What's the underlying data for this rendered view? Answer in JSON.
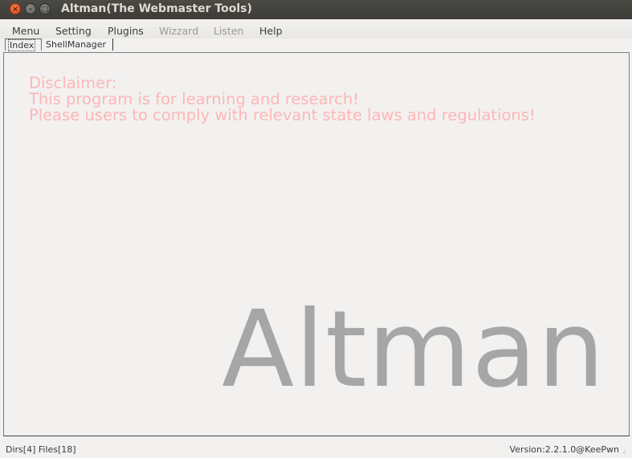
{
  "window": {
    "title": "Altman(The Webmaster Tools)",
    "close_glyph": "×",
    "minimize_glyph": "–",
    "maximize_glyph": "□"
  },
  "menubar": {
    "items": [
      {
        "label": "Menu",
        "enabled": true
      },
      {
        "label": "Setting",
        "enabled": true
      },
      {
        "label": "Plugins",
        "enabled": true
      },
      {
        "label": "Wizzard",
        "enabled": false
      },
      {
        "label": "Listen",
        "enabled": false
      },
      {
        "label": "Help",
        "enabled": true
      }
    ]
  },
  "tabs": [
    {
      "label": "Index",
      "selected": true
    },
    {
      "label": "ShellManager",
      "selected": false
    }
  ],
  "main": {
    "disclaimer": [
      "Disclaimer:",
      "This program is for learning and research!",
      "Please users to comply with relevant state laws and regulations!"
    ],
    "logo_text": "Altman"
  },
  "statusbar": {
    "left": "Dirs[4] Files[18]",
    "right": "Version:2.2.1.0@KeePwn",
    "grip": ".:"
  },
  "colors": {
    "disclaimer_text": "#ffb6b6",
    "logo_text": "#a6a6a6",
    "titlebar": "#3c3b37",
    "close_button": "#df4a16"
  }
}
